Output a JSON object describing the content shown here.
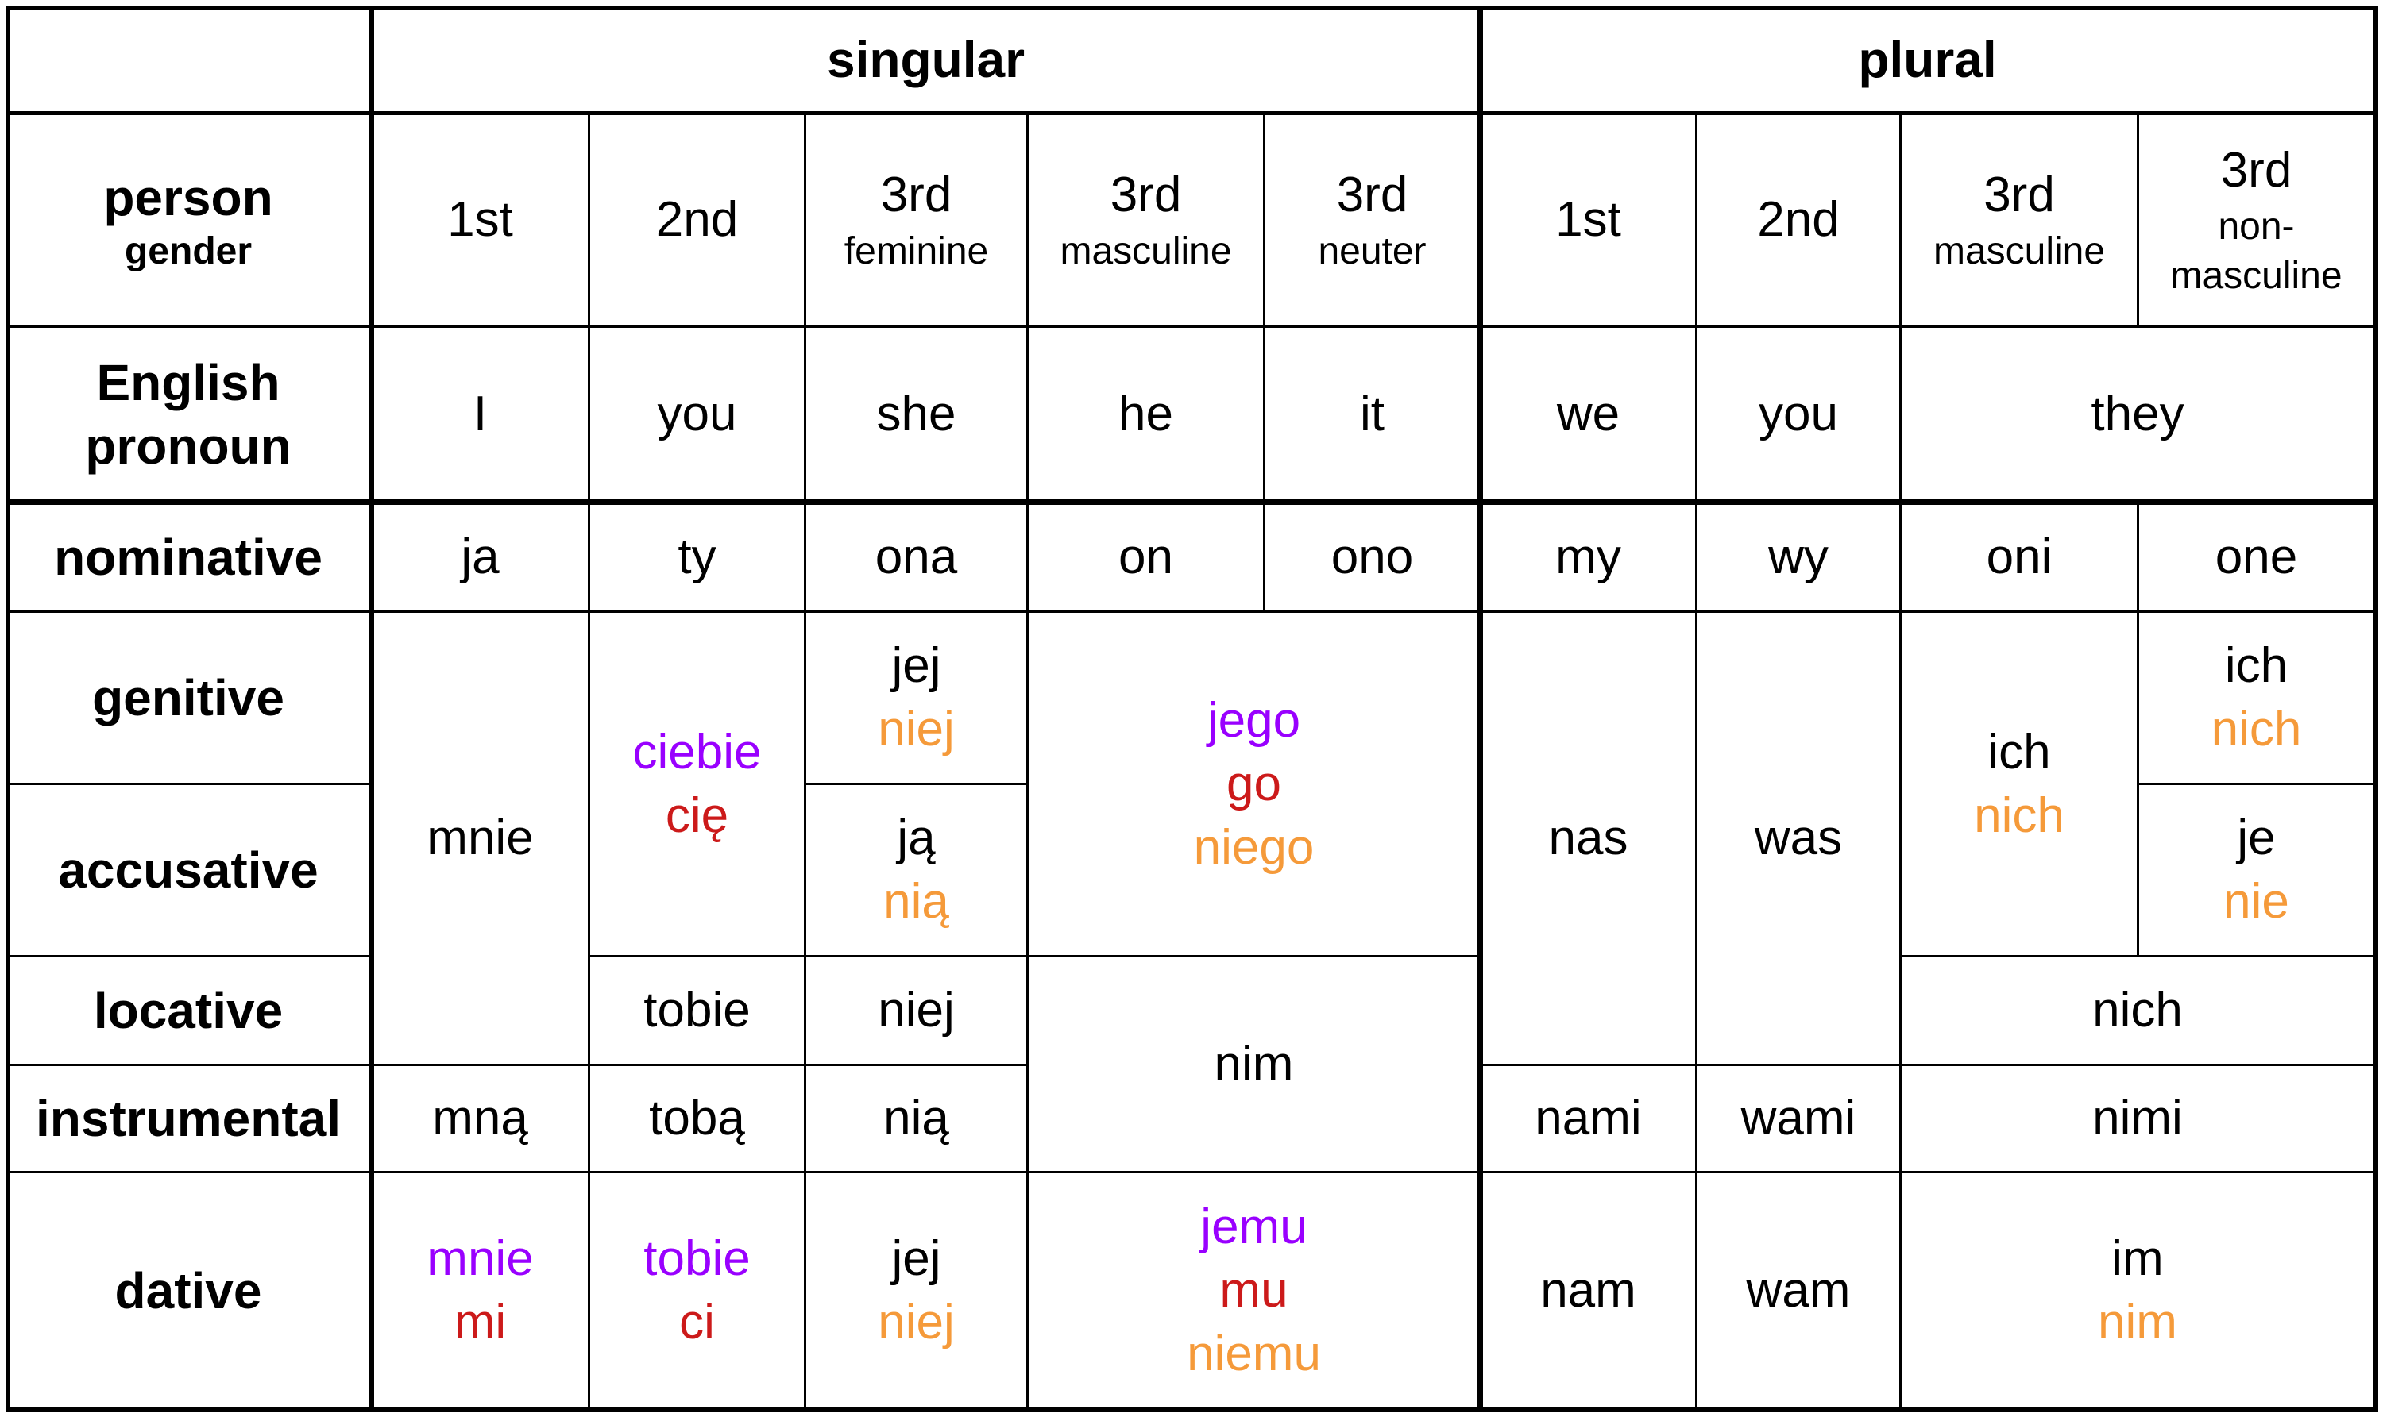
{
  "table": {
    "title_groups": {
      "singular": "singular",
      "plural": "plural"
    },
    "row_headers": {
      "person": "person",
      "gender": "gender",
      "english_line1": "English",
      "english_line2": "pronoun",
      "nominative": "nominative",
      "genitive": "genitive",
      "accusative": "accusative",
      "locative": "locative",
      "instrumental": "instrumental",
      "dative": "dative"
    },
    "persons": {
      "sg1": {
        "person": "1st"
      },
      "sg2": {
        "person": "2nd"
      },
      "sg3f": {
        "person": "3rd",
        "gender": "feminine"
      },
      "sg3m": {
        "person": "3rd",
        "gender": "masculine"
      },
      "sg3n": {
        "person": "3rd",
        "gender": "neuter"
      },
      "pl1": {
        "person": "1st"
      },
      "pl2": {
        "person": "2nd"
      },
      "pl3m": {
        "person": "3rd",
        "gender": "masculine"
      },
      "pl3nm": {
        "person": "3rd",
        "gender_line1": "non-",
        "gender_line2": "masculine"
      }
    },
    "english": {
      "sg1": "I",
      "sg2": "you",
      "sg3f": "she",
      "sg3m": "he",
      "sg3n": "it",
      "pl1": "we",
      "pl2": "you",
      "pl3": "they"
    },
    "nominative": {
      "sg1": "ja",
      "sg2": "ty",
      "sg3f": "ona",
      "sg3m": "on",
      "sg3n": "ono",
      "pl1": "my",
      "pl2": "wy",
      "pl3m": "oni",
      "pl3nm": "one"
    },
    "forms": {
      "sg1_gen_acc_loc": "mnie",
      "sg2_gen_acc": [
        "ciebie",
        "cię"
      ],
      "sg3f_gen": [
        "jej",
        "niej"
      ],
      "sg3f_acc": [
        "ją",
        "nią"
      ],
      "sg3mn_gen_acc": [
        "jego",
        "go",
        "niego"
      ],
      "pl1_gen_acc_loc": "nas",
      "pl2_gen_acc_loc": "was",
      "pl3m_gen_acc": [
        "ich",
        "nich"
      ],
      "pl3nm_gen": [
        "ich",
        "nich"
      ],
      "pl3nm_acc": [
        "je",
        "nie"
      ],
      "sg2_loc": "tobie",
      "sg3f_loc": "niej",
      "sg3mn_loc_ins": "nim",
      "pl3_loc": "nich",
      "sg1_ins": "mną",
      "sg2_ins": "tobą",
      "sg3f_ins": "nią",
      "pl1_ins": "nami",
      "pl2_ins": "wami",
      "pl3_ins": "nimi",
      "sg1_dat": [
        "mnie",
        "mi"
      ],
      "sg2_dat": [
        "tobie",
        "ci"
      ],
      "sg3f_dat": [
        "jej",
        "niej"
      ],
      "sg3mn_dat": [
        "jemu",
        "mu",
        "niemu"
      ],
      "pl1_dat": "nam",
      "pl2_dat": "wam",
      "pl3_dat": [
        "im",
        "nim"
      ]
    },
    "colors": {
      "long_form": "#9900ff",
      "short_form": "#cc1a1a",
      "after_preposition": "#f59a3a",
      "default": "#000000"
    }
  }
}
